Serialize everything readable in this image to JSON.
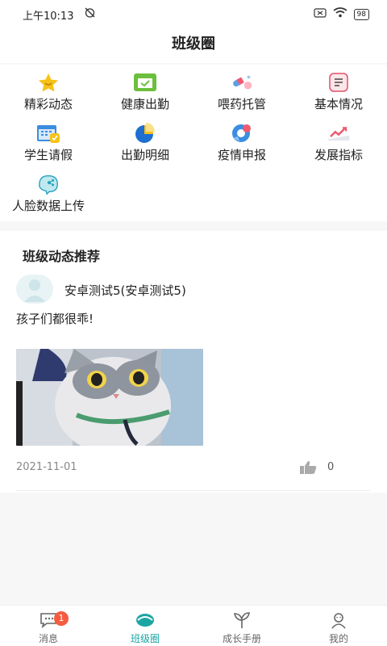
{
  "status": {
    "time": "上午10:13",
    "battery": "98"
  },
  "header": {
    "title": "班级圈"
  },
  "menu": [
    {
      "label": "精彩动态",
      "icon": "star-icon"
    },
    {
      "label": "健康出勤",
      "icon": "calendar-check-icon"
    },
    {
      "label": "喂药托管",
      "icon": "medicine-icon"
    },
    {
      "label": "基本情况",
      "icon": "document-icon"
    },
    {
      "label": "学生请假",
      "icon": "leave-calendar-icon"
    },
    {
      "label": "出勤明细",
      "icon": "pie-chart-icon"
    },
    {
      "label": "疫情申报",
      "icon": "virus-report-icon"
    },
    {
      "label": "发展指标",
      "icon": "trend-chart-icon"
    },
    {
      "label": "人脸数据上传",
      "icon": "face-upload-icon"
    }
  ],
  "feed": {
    "title": "班级动态推荐",
    "posts": [
      {
        "author": "安卓测试5(安卓测试5)",
        "text": "孩子们都很乖!",
        "date": "2021-11-01",
        "likes": "0"
      }
    ]
  },
  "tabs": [
    {
      "label": "消息",
      "icon": "message-icon",
      "badge": "1"
    },
    {
      "label": "班级圈",
      "icon": "class-circle-icon"
    },
    {
      "label": "成长手册",
      "icon": "sprout-icon"
    },
    {
      "label": "我的",
      "icon": "user-icon"
    }
  ],
  "colors": {
    "accent": "#1ba6a3",
    "badge": "#f45b40",
    "yellow": "#f6c21a"
  }
}
